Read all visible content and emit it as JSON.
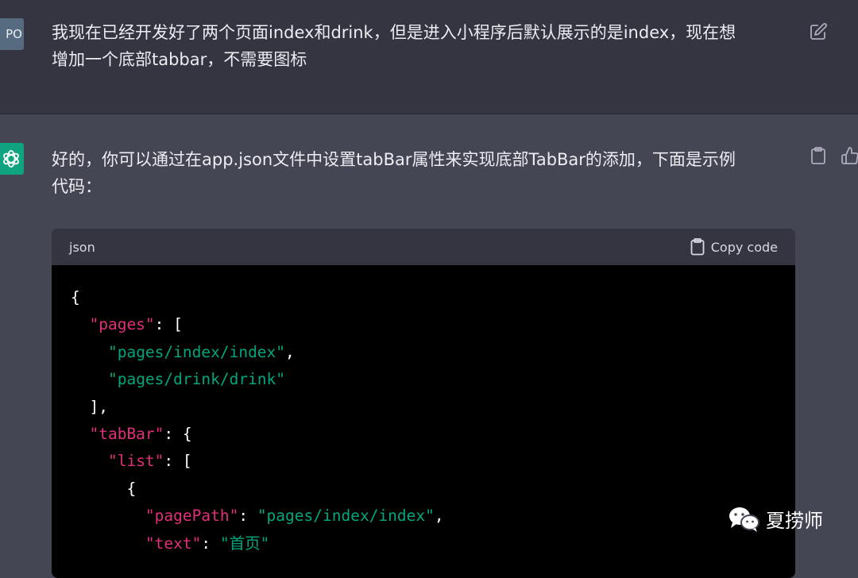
{
  "user_message": {
    "avatar_text": "PO",
    "line1": "我现在已经开发好了两个页面index和drink，但是进入小程序后默认展示的是index，现在想",
    "line2": "增加一个底部tabbar，不需要图标"
  },
  "assistant_message": {
    "line1": "好的，你可以通过在app.json文件中设置tabBar属性来实现底部TabBar的添加，下面是示例",
    "line2": "代码："
  },
  "code_block": {
    "language": "json",
    "copy_label": "Copy code",
    "lines": [
      [
        {
          "t": "p",
          "v": "{"
        }
      ],
      [
        {
          "t": "p",
          "v": "  "
        },
        {
          "t": "k",
          "v": "\"pages\""
        },
        {
          "t": "p",
          "v": ": ["
        }
      ],
      [
        {
          "t": "p",
          "v": "    "
        },
        {
          "t": "s",
          "v": "\"pages/index/index\""
        },
        {
          "t": "p",
          "v": ","
        }
      ],
      [
        {
          "t": "p",
          "v": "    "
        },
        {
          "t": "s",
          "v": "\"pages/drink/drink\""
        }
      ],
      [
        {
          "t": "p",
          "v": "  ],"
        }
      ],
      [
        {
          "t": "p",
          "v": "  "
        },
        {
          "t": "k",
          "v": "\"tabBar\""
        },
        {
          "t": "p",
          "v": ": {"
        }
      ],
      [
        {
          "t": "p",
          "v": "    "
        },
        {
          "t": "k",
          "v": "\"list\""
        },
        {
          "t": "p",
          "v": ": ["
        }
      ],
      [
        {
          "t": "p",
          "v": "      {"
        }
      ],
      [
        {
          "t": "p",
          "v": "        "
        },
        {
          "t": "k",
          "v": "\"pagePath\""
        },
        {
          "t": "p",
          "v": ": "
        },
        {
          "t": "s",
          "v": "\"pages/index/index\""
        },
        {
          "t": "p",
          "v": ","
        }
      ],
      [
        {
          "t": "p",
          "v": "        "
        },
        {
          "t": "k",
          "v": "\"text\""
        },
        {
          "t": "p",
          "v": ": "
        },
        {
          "t": "s",
          "v": "\"首页\""
        }
      ]
    ]
  },
  "watermark": {
    "icon": "wechat-icon",
    "text": "夏捞师"
  },
  "colors": {
    "user_bg": "#343541",
    "assistant_bg": "#444654",
    "ai_avatar": "#10a37f",
    "code_key": "#df3079",
    "code_string": "#00a67d"
  },
  "icons": [
    "edit-icon",
    "clipboard-icon",
    "thumbs-up-icon",
    "openai-logo-icon"
  ]
}
